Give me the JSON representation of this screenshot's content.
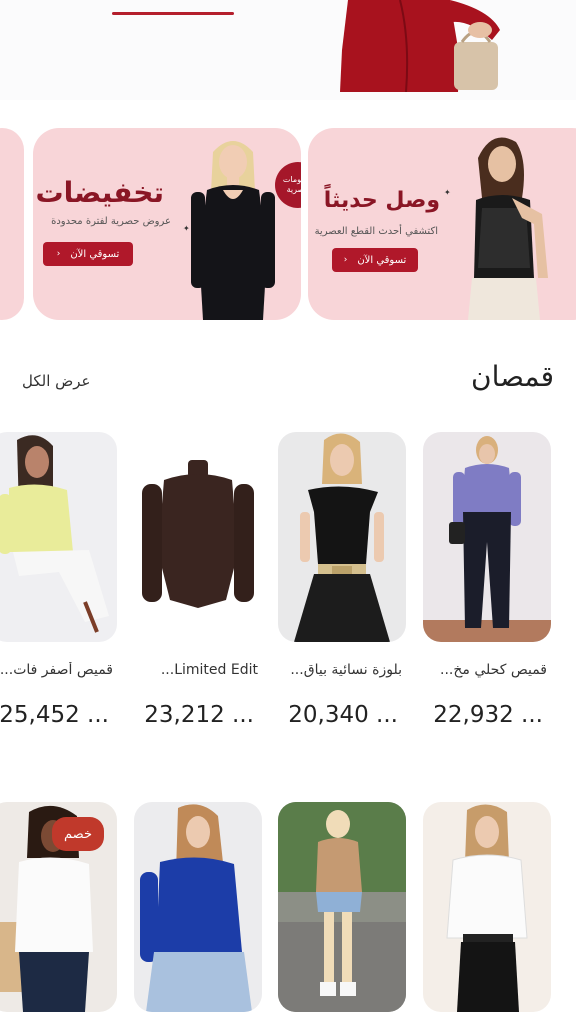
{
  "colors": {
    "accent": "#b0182a",
    "banner_bg": "#f8d5d8",
    "badge": "#c0392b"
  },
  "banners": {
    "sale": {
      "title": "تخفيضات",
      "subtitle": "عروض حصرية لفترة محدودة",
      "button": "تسوقي الآن",
      "badge": "خصومات حصرية"
    },
    "new": {
      "title": "وصل حديثاً",
      "subtitle": "اكتشفي أحدث القطع العصرية",
      "button": "تسوقي الآن"
    }
  },
  "section": {
    "title": "قمصان",
    "view_all": "عرض الكل"
  },
  "products": [
    {
      "name": "قميص كحلي مخ...",
      "price": "22,932 ..."
    },
    {
      "name": "بلوزة نسائية بياق...",
      "price": "20,340 ..."
    },
    {
      "name": "Limited Edit...",
      "price": "23,212 ..."
    },
    {
      "name": "قميص أصفر فات...",
      "price": "25,452 ..."
    }
  ],
  "row2": {
    "sale_badge": "خصم"
  }
}
